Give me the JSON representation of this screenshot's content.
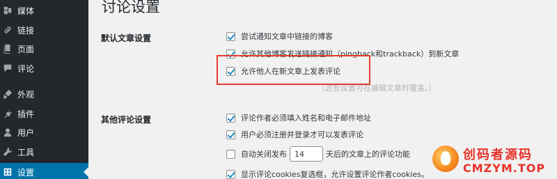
{
  "sidebar": {
    "items": [
      {
        "label": "媒体",
        "icon": "media-icon"
      },
      {
        "label": "链接",
        "icon": "link-icon"
      },
      {
        "label": "页面",
        "icon": "page-icon"
      },
      {
        "label": "评论",
        "icon": "comment-icon"
      },
      {
        "label": "外观",
        "icon": "appearance-brush-icon"
      },
      {
        "label": "插件",
        "icon": "plugin-icon"
      },
      {
        "label": "用户",
        "icon": "user-icon"
      },
      {
        "label": "工具",
        "icon": "wrench-icon"
      },
      {
        "label": "设置",
        "icon": "settings-icon",
        "active": true
      }
    ]
  },
  "page": {
    "title": "讨论设置"
  },
  "sections": {
    "default_article": {
      "label": "默认文章设置",
      "options": [
        {
          "label": "尝试通知文章中链接的博客",
          "checked": true
        },
        {
          "label": "允许其他博客发送链接通知（pingback和trackback）到新文章",
          "checked": true
        },
        {
          "label": "允许他人在新文章上发表评论",
          "checked": true
        }
      ],
      "note": "（这些设置可在编辑文章时覆盖。）"
    },
    "other_comment": {
      "label": "其他评论设置",
      "options": [
        {
          "label": "评论作者必须填入姓名和电子邮件地址",
          "checked": true
        },
        {
          "label": "用户必须注册并登录才可以发表评论",
          "checked": true
        },
        {
          "label_before": "自动关闭发布",
          "value": "14",
          "label_after": "天后的文章上的评论功能",
          "checked": false
        },
        {
          "label": "显示评论cookies复选框，允许设置评论作者cookies。",
          "checked": true
        }
      ]
    }
  },
  "watermark": {
    "line1": "创码者源码",
    "line2": "CMZYM.TOP"
  },
  "colors": {
    "sidebar_bg": "#23282d",
    "active_bg": "#0073aa",
    "highlight": "#e53b2c",
    "check": "#1e8cbe"
  }
}
